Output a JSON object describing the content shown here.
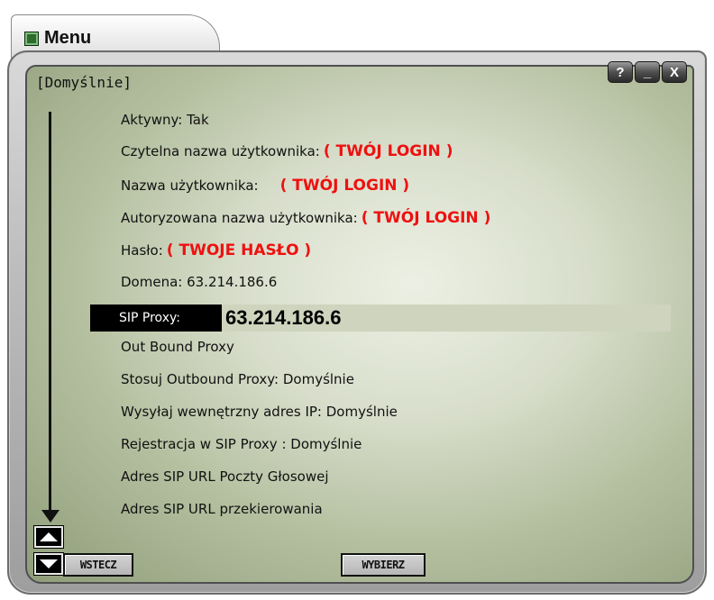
{
  "window": {
    "tab_title": "Menu",
    "header": "[Domyślnie]",
    "buttons": {
      "help": "?",
      "minimize": "_",
      "close": "X"
    }
  },
  "settings": {
    "active": "Aktywny: Tak",
    "display_name_label": "Czytelna nazwa użytkownika:",
    "display_name_value": "( TWÓJ LOGIN )",
    "username_label": "Nazwa użytkownika:",
    "username_value": "( TWÓJ LOGIN )",
    "auth_name_label": "Autoryzowana nazwa użytkownika:",
    "auth_name_value": "( TWÓJ LOGIN )",
    "password_label": "Hasło:",
    "password_value": "( TWOJE HASŁO )",
    "domain": "Domena: 63.214.186.6",
    "sip_proxy_label": "SIP Proxy:",
    "sip_proxy_value": "63.214.186.6",
    "outbound_proxy": "Out Bound Proxy",
    "use_outbound_proxy": "Stosuj Outbound Proxy: Domyślnie",
    "send_internal_ip": "Wysyłaj wewnętrzny adres IP: Domyślnie",
    "sip_registration": "Rejestracja w SIP Proxy : Domyślnie",
    "voicemail_url": "Adres SIP URL Poczty Głosowej",
    "forward_url": "Adres SIP URL przekierowania"
  },
  "softkeys": {
    "back": "WSTECZ",
    "select": "WYBIERZ"
  }
}
